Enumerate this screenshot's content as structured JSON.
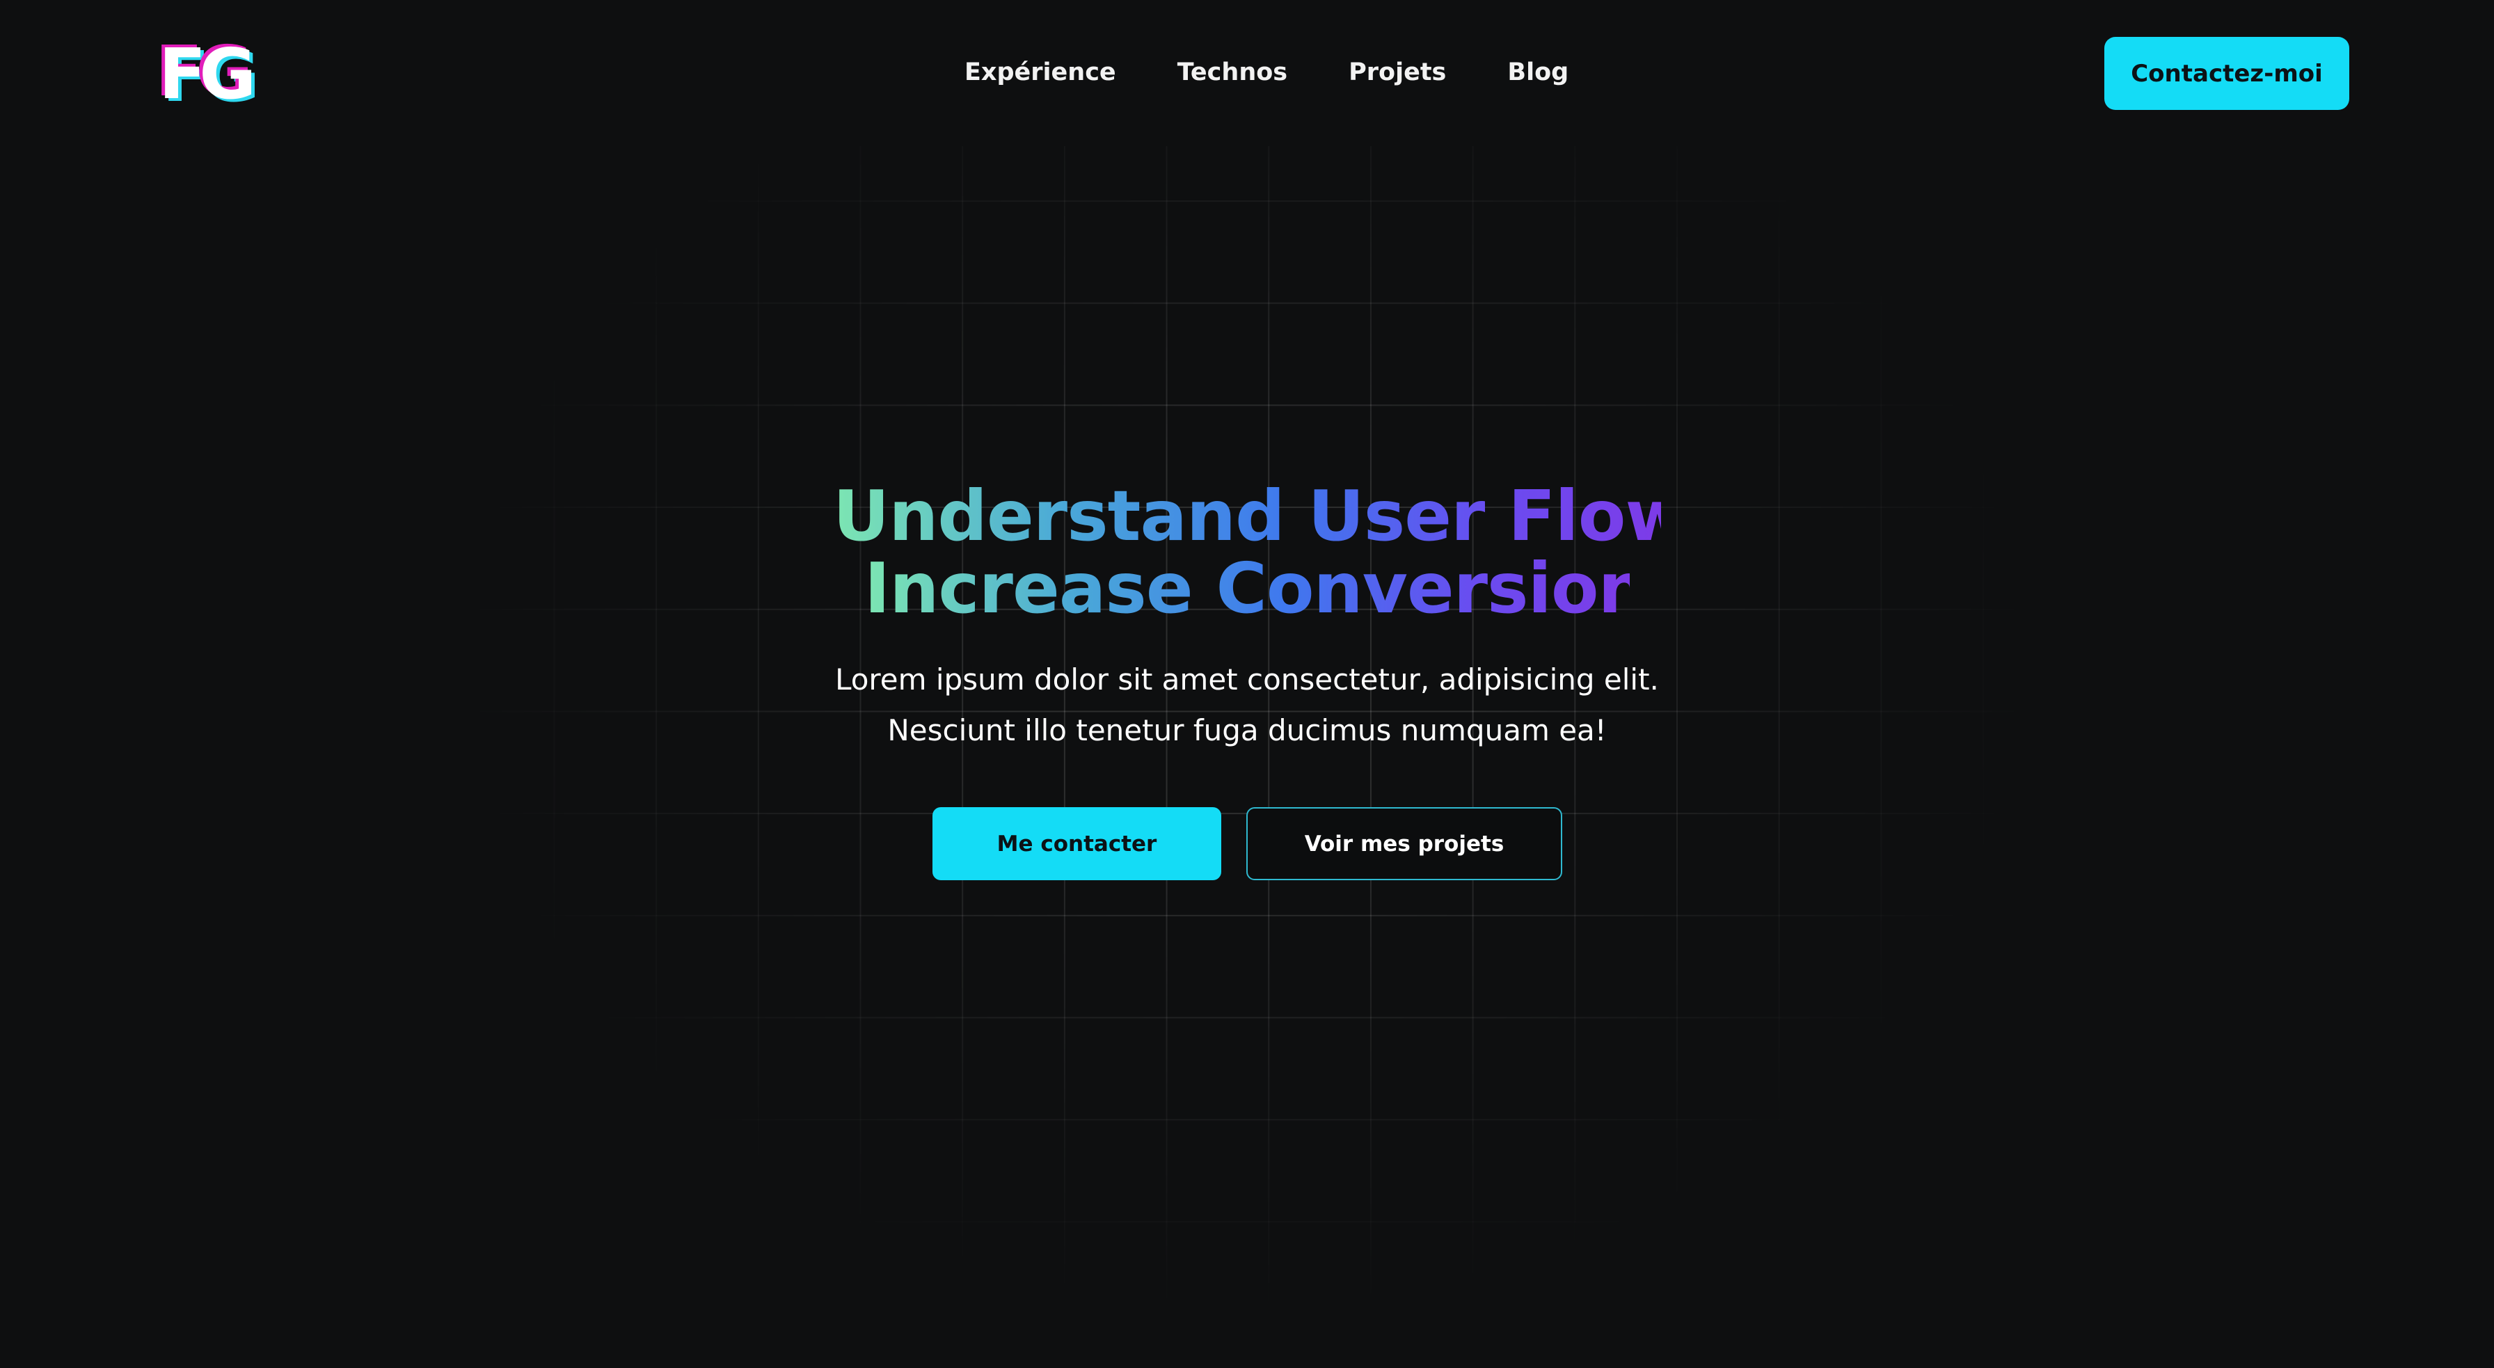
{
  "header": {
    "logo_text": "FG",
    "nav": [
      {
        "label": "Expérience"
      },
      {
        "label": "Technos"
      },
      {
        "label": "Projets"
      },
      {
        "label": "Blog"
      }
    ],
    "contact_label": "Contactez-moi"
  },
  "hero": {
    "title_line1": "Understand User Flow.",
    "title_line2": "Increase Conversion.",
    "subtitle_line1": "Lorem ipsum dolor sit amet consectetur, adipisicing elit.",
    "subtitle_line2": "Nesciunt illo tenetur fuga ducimus numquam ea!",
    "primary_cta": "Me contacter",
    "secondary_cta": "Voir mes projets"
  },
  "colors": {
    "background": "#0e0f10",
    "accent": "#14dcf6",
    "gradient_start": "#7de6b2",
    "gradient_mid": "#3f78ee",
    "gradient_end": "#7d3be8"
  }
}
